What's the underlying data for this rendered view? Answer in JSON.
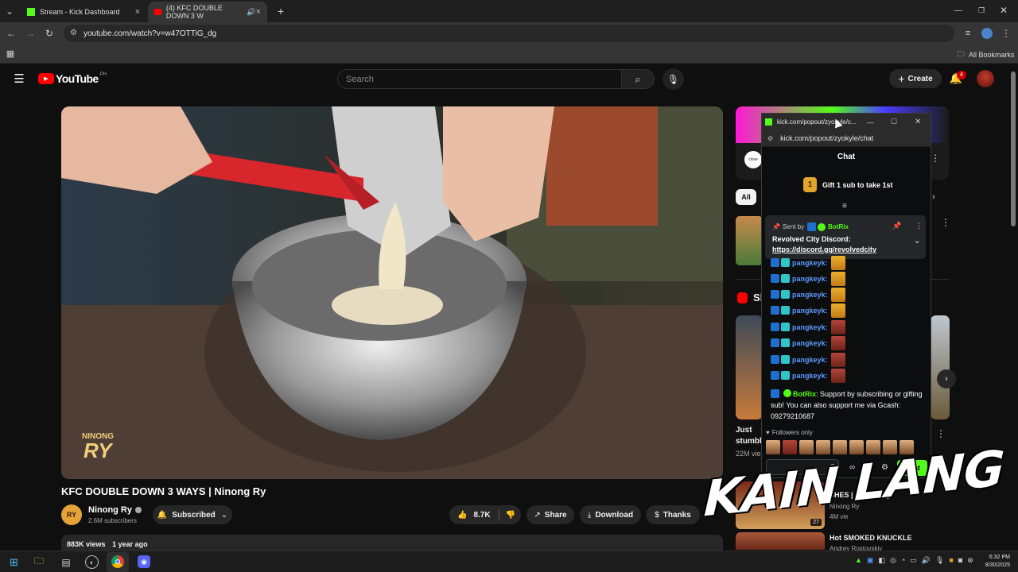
{
  "browser": {
    "tabs": [
      {
        "title": "Stream - Kick Dashboard"
      },
      {
        "title": "(4) KFC DOUBLE DOWN 3 W"
      }
    ],
    "url": "youtube.com/watch?v=w47OTTiG_dg",
    "bookmarks_label": "All Bookmarks",
    "new_tab_glyph": "+",
    "close_glyph": "×"
  },
  "youtube": {
    "logo_text": "YouTube",
    "region": "PH",
    "search_placeholder": "Search",
    "create_label": "Create",
    "notif_count": "4",
    "video_title": "KFC DOUBLE DOWN 3 WAYS | Ninong Ry",
    "watermark_top": "NINONG",
    "watermark_bottom": "RY",
    "channel_name": "Ninong Ry",
    "channel_avatar": "RY",
    "subscribers": "2.6M subscribers",
    "subscribed_label": "Subscribed",
    "likes": "8.7K",
    "share_label": "Share",
    "download_label": "Download",
    "thanks_label": "Thanks",
    "views": "883K views",
    "age": "1 year ago",
    "filter_all": "All",
    "sidebar_channel_badge": "close",
    "shorts_label": "Sh",
    "short_title": "Just stumbl",
    "short_views": "22M vie",
    "rec1_title": "SHES | Ninong Ry",
    "rec1_channel": "Ninong Ry",
    "rec1_meta": "4M vie",
    "rec1_duration": "27",
    "rec2_title": "Hot SMOKED KNUCKLE",
    "rec2_channel": "Andrey Rostovskiy"
  },
  "chat_popout": {
    "window_title": "kick.com/popout/zyokyle/c...",
    "url": "kick.com/popout/zyokyle/chat",
    "header": "Chat",
    "gift_rank": "1",
    "gift_text": "Gift 1 sub to take 1st",
    "pinned": {
      "sent_by": "Sent by",
      "author": "BotRix",
      "line1": "Revolved City Discord:",
      "link": "https://discord.gg/revolvedcity"
    },
    "messages": [
      {
        "user": "pangkeyk",
        "emote": "gold"
      },
      {
        "user": "pangkeyk",
        "emote": "gold"
      },
      {
        "user": "pangkeyk",
        "emote": "gold"
      },
      {
        "user": "pangkeyk",
        "emote": "gold"
      },
      {
        "user": "pangkeyk",
        "emote": "red"
      },
      {
        "user": "pangkeyk",
        "emote": "red"
      },
      {
        "user": "pangkeyk",
        "emote": "red"
      },
      {
        "user": "pangkeyk",
        "emote": "red"
      }
    ],
    "bot_message": {
      "user": "BotRix",
      "text": "Support by subscribing or gifting sub! You can also support me via Gcash: 09279210687"
    },
    "followers_only": "Followers only",
    "chat_button": "Chat"
  },
  "overlay_text": "KAIN LANG",
  "taskbar": {
    "time": "6:32 PM",
    "date": "8/30/2025"
  },
  "colors": {
    "kick_green": "#53fc18",
    "yt_red": "#ff0000",
    "link_blue": "#5b9bff"
  }
}
